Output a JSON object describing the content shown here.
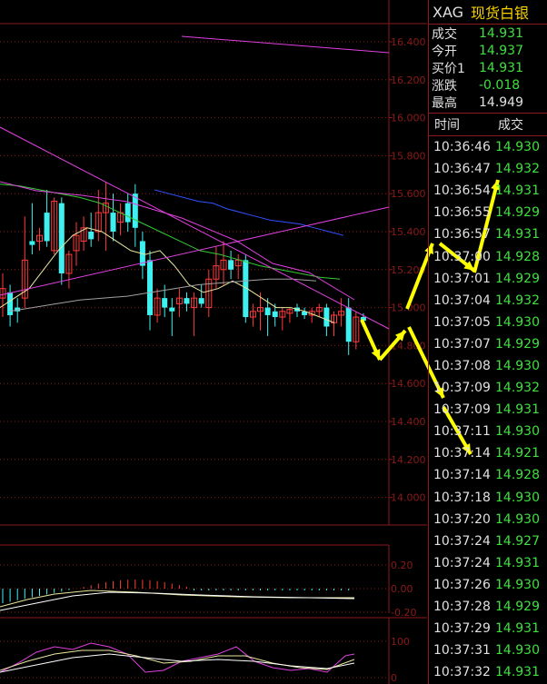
{
  "header": {
    "code": "XAG",
    "name": "现货白银"
  },
  "quote": [
    {
      "label": "成交",
      "value": "14.931"
    },
    {
      "label": "今开",
      "value": "14.937"
    },
    {
      "label": "买价1",
      "value": "14.931"
    },
    {
      "label": "涨跌",
      "value": "-0.018"
    },
    {
      "label": "最高",
      "value": "14.949"
    }
  ],
  "trades_header": {
    "time": "时间",
    "price": "成交"
  },
  "trades": [
    {
      "time": "10:36:46",
      "price": "14.930"
    },
    {
      "time": "10:36:47",
      "price": "14.932"
    },
    {
      "time": "10:36:54",
      "price": "14.931"
    },
    {
      "time": "10:36:55",
      "price": "14.929"
    },
    {
      "time": "10:36:57",
      "price": "14.931"
    },
    {
      "time": "10:37:00",
      "price": "14.928"
    },
    {
      "time": "10:37:01",
      "price": "14.929"
    },
    {
      "time": "10:37:04",
      "price": "14.932"
    },
    {
      "time": "10:37:05",
      "price": "14.930"
    },
    {
      "time": "10:37:07",
      "price": "14.929"
    },
    {
      "time": "10:37:08",
      "price": "14.930"
    },
    {
      "time": "10:37:09",
      "price": "14.932"
    },
    {
      "time": "10:37:09",
      "price": "14.931"
    },
    {
      "time": "10:37:11",
      "price": "14.930"
    },
    {
      "time": "10:37:14",
      "price": "14.921"
    },
    {
      "time": "10:37:14",
      "price": "14.928"
    },
    {
      "time": "10:37:18",
      "price": "14.930"
    },
    {
      "time": "10:37:20",
      "price": "14.930"
    },
    {
      "time": "10:37:24",
      "price": "14.927"
    },
    {
      "time": "10:37:24",
      "price": "14.931"
    },
    {
      "time": "10:37:26",
      "price": "14.930"
    },
    {
      "time": "10:37:28",
      "price": "14.929"
    },
    {
      "time": "10:37:29",
      "price": "14.931"
    },
    {
      "time": "10:37:31",
      "price": "14.930"
    },
    {
      "time": "10:37:32",
      "price": "14.931"
    }
  ],
  "colors": {
    "up": "#ff3b3b",
    "down": "#3ff0f0",
    "grid": "#8b1a1a",
    "ma_yellow": "#e8e8a0",
    "ma_green": "#33cc33",
    "ma_blue": "#3050ff",
    "ma_grey": "#a0a0a0",
    "trend_magenta": "#e040e0",
    "arrow_yellow": "#ffff00"
  },
  "main_axis": {
    "labels": [
      "16.400",
      "16.200",
      "16.000",
      "15.800",
      "15.600",
      "15.400",
      "15.200",
      "15.000",
      "14.800",
      "14.600",
      "14.400",
      "14.200",
      "14.000"
    ],
    "min": 14.0,
    "max": 16.4
  },
  "macd_axis": {
    "labels": [
      "0.20",
      "0.00",
      "-0.20"
    ]
  },
  "kdj_axis": {
    "labels": [
      "100",
      "0"
    ]
  },
  "chart_data": {
    "type": "candlestick",
    "ylim": [
      14.0,
      16.4
    ],
    "candles": [
      {
        "o": 15.05,
        "h": 15.18,
        "l": 14.95,
        "c": 15.1
      },
      {
        "o": 15.08,
        "h": 15.12,
        "l": 14.9,
        "c": 14.96
      },
      {
        "o": 15.0,
        "h": 15.05,
        "l": 14.92,
        "c": 14.98
      },
      {
        "o": 15.05,
        "h": 15.48,
        "l": 15.0,
        "c": 15.25
      },
      {
        "o": 15.35,
        "h": 15.55,
        "l": 15.28,
        "c": 15.33
      },
      {
        "o": 15.35,
        "h": 15.42,
        "l": 15.3,
        "c": 15.38
      },
      {
        "o": 15.5,
        "h": 15.62,
        "l": 15.32,
        "c": 15.35
      },
      {
        "o": 15.3,
        "h": 15.58,
        "l": 15.28,
        "c": 15.56
      },
      {
        "o": 15.55,
        "h": 15.58,
        "l": 15.12,
        "c": 15.18
      },
      {
        "o": 15.18,
        "h": 15.3,
        "l": 15.1,
        "c": 15.28
      },
      {
        "o": 15.3,
        "h": 15.45,
        "l": 15.22,
        "c": 15.38
      },
      {
        "o": 15.35,
        "h": 15.48,
        "l": 15.3,
        "c": 15.42
      },
      {
        "o": 15.4,
        "h": 15.5,
        "l": 15.32,
        "c": 15.36
      },
      {
        "o": 15.4,
        "h": 15.62,
        "l": 15.35,
        "c": 15.5
      },
      {
        "o": 15.5,
        "h": 15.66,
        "l": 15.3,
        "c": 15.55
      },
      {
        "o": 15.5,
        "h": 15.6,
        "l": 15.35,
        "c": 15.4
      },
      {
        "o": 15.45,
        "h": 15.55,
        "l": 15.38,
        "c": 15.5
      },
      {
        "o": 15.55,
        "h": 15.6,
        "l": 15.4,
        "c": 15.45
      },
      {
        "o": 15.6,
        "h": 15.65,
        "l": 15.32,
        "c": 15.42
      },
      {
        "o": 15.35,
        "h": 15.4,
        "l": 15.15,
        "c": 15.22
      },
      {
        "o": 15.25,
        "h": 15.3,
        "l": 14.88,
        "c": 14.96
      },
      {
        "o": 14.96,
        "h": 15.1,
        "l": 14.92,
        "c": 15.05
      },
      {
        "o": 15.05,
        "h": 15.12,
        "l": 14.95,
        "c": 15.0
      },
      {
        "o": 15.0,
        "h": 15.05,
        "l": 14.85,
        "c": 14.98
      },
      {
        "o": 15.02,
        "h": 15.1,
        "l": 14.95,
        "c": 15.05
      },
      {
        "o": 15.05,
        "h": 15.08,
        "l": 14.98,
        "c": 15.02
      },
      {
        "o": 15.0,
        "h": 15.08,
        "l": 14.85,
        "c": 15.05
      },
      {
        "o": 15.05,
        "h": 15.12,
        "l": 15.0,
        "c": 15.02
      },
      {
        "o": 15.0,
        "h": 15.2,
        "l": 14.95,
        "c": 15.15
      },
      {
        "o": 15.15,
        "h": 15.32,
        "l": 15.1,
        "c": 15.22
      },
      {
        "o": 15.2,
        "h": 15.35,
        "l": 15.12,
        "c": 15.25
      },
      {
        "o": 15.25,
        "h": 15.3,
        "l": 15.15,
        "c": 15.2
      },
      {
        "o": 15.22,
        "h": 15.28,
        "l": 15.15,
        "c": 15.25
      },
      {
        "o": 15.25,
        "h": 15.28,
        "l": 14.92,
        "c": 14.95
      },
      {
        "o": 14.95,
        "h": 15.02,
        "l": 14.9,
        "c": 14.98
      },
      {
        "o": 14.98,
        "h": 15.08,
        "l": 14.88,
        "c": 15.0
      },
      {
        "o": 15.0,
        "h": 15.05,
        "l": 14.85,
        "c": 14.96
      },
      {
        "o": 14.98,
        "h": 15.02,
        "l": 14.9,
        "c": 14.95
      },
      {
        "o": 14.95,
        "h": 15.0,
        "l": 14.88,
        "c": 14.98
      },
      {
        "o": 14.97,
        "h": 15.0,
        "l": 14.92,
        "c": 14.99
      },
      {
        "o": 15.0,
        "h": 15.02,
        "l": 14.95,
        "c": 14.98
      },
      {
        "o": 14.98,
        "h": 15.0,
        "l": 14.94,
        "c": 14.96
      },
      {
        "o": 14.96,
        "h": 15.0,
        "l": 14.92,
        "c": 14.98
      },
      {
        "o": 14.98,
        "h": 15.02,
        "l": 14.95,
        "c": 15.0
      },
      {
        "o": 15.0,
        "h": 15.02,
        "l": 14.85,
        "c": 14.9
      },
      {
        "o": 14.92,
        "h": 14.98,
        "l": 14.85,
        "c": 14.96
      },
      {
        "o": 14.96,
        "h": 15.05,
        "l": 14.9,
        "c": 14.98
      },
      {
        "o": 15.0,
        "h": 15.05,
        "l": 14.75,
        "c": 14.82
      },
      {
        "o": 14.82,
        "h": 14.98,
        "l": 14.78,
        "c": 14.95
      },
      {
        "o": 14.95,
        "h": 14.97,
        "l": 14.9,
        "c": 14.93
      }
    ],
    "ma_series": [
      {
        "color": "#e8e8a0",
        "values": [
          15.0,
          15.05,
          15.1,
          15.2,
          15.3,
          15.38,
          15.42,
          15.4,
          15.35,
          15.3,
          15.28,
          15.3,
          15.22,
          15.12,
          15.08,
          15.1,
          15.14,
          15.1,
          15.05,
          15.0,
          15.0,
          14.98,
          14.95,
          14.92
        ]
      },
      {
        "color": "#33cc33",
        "values": [
          15.65,
          15.64,
          15.62,
          15.6,
          15.58,
          15.55,
          15.5,
          15.45,
          15.4,
          15.35,
          15.3,
          15.28,
          15.25,
          15.22,
          15.2,
          15.18,
          15.16,
          15.15
        ]
      },
      {
        "color": "#3050ff",
        "values": [
          15.62,
          15.6,
          15.58,
          15.56,
          15.55,
          15.52,
          15.5,
          15.48,
          15.46,
          15.45,
          15.44,
          15.42,
          15.4,
          15.38
        ]
      },
      {
        "color": "#a0a0a0",
        "values": [
          14.98,
          15.0,
          15.02,
          15.04,
          15.05,
          15.06,
          15.08,
          15.1,
          15.12,
          15.13,
          15.14,
          15.15,
          15.15,
          15.14
        ]
      }
    ]
  }
}
